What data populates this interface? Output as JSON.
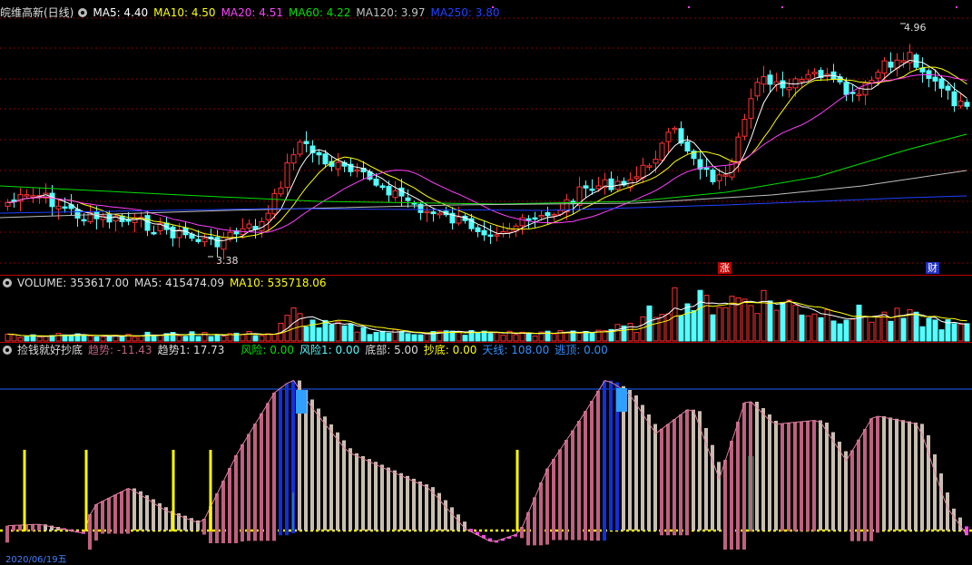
{
  "main_header": {
    "stock": "皖维高新(日线)",
    "ma5": "MA5: 4.40",
    "ma10": "MA10: 4.50",
    "ma20": "MA20: 4.51",
    "ma60": "MA60: 4.22",
    "ma120": "MA120: 3.97",
    "ma250": "MA250: 3.80"
  },
  "price_labels": {
    "high": "4.96",
    "low": "3.38"
  },
  "badges": {
    "zhang": "涨",
    "cai": "财"
  },
  "volume_header": {
    "volume": "VOLUME: 353617.00",
    "ma5": "MA5: 415474.09",
    "ma10": "MA10: 535718.06"
  },
  "ind_header": {
    "name": "捡钱就好抄底",
    "trend": "趋势: -11.43",
    "trend1": "趋势1: 17.73",
    "risk": "风险: 0.00",
    "risk1": "风险1: 0.00",
    "bottom": "底部: 5.00",
    "chaodi": "抄底: 0.00",
    "tianxian": "天线: 108.00",
    "taoding": "逃顶: 0.00"
  },
  "bottom_axis": {
    "date_label": "2020/06/19五"
  },
  "colors": {
    "up": "#ff3232",
    "down": "#54ffff",
    "ma5": "#ffffff",
    "ma10": "#ffff00",
    "ma20": "#ff40ff",
    "ma60": "#00e000",
    "ma120": "#c0c0c0",
    "ma250": "#2040ff",
    "grid": "#8a0000",
    "pink": "#c06080",
    "beige": "#c8beb0",
    "blue": "#2060ff"
  }
}
